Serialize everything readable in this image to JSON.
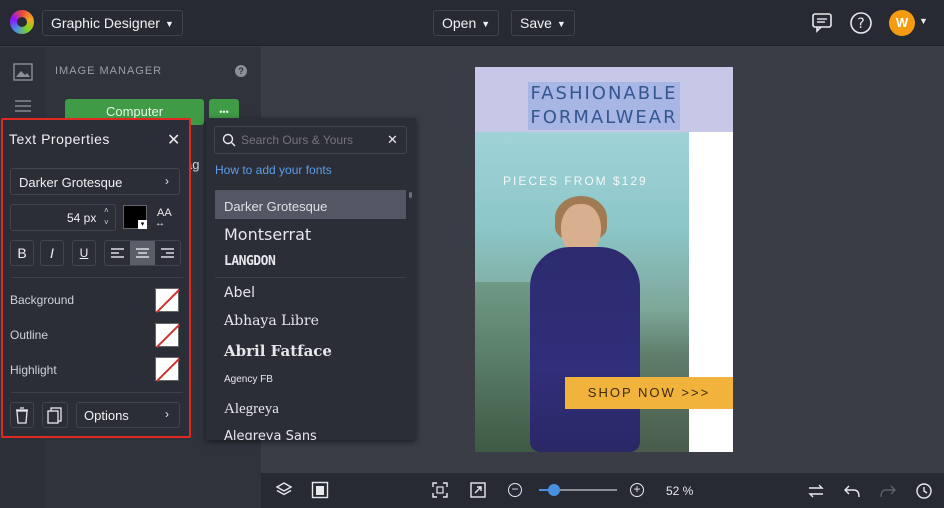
{
  "app": {
    "title_selector": "Graphic Designer"
  },
  "toolbar": {
    "open_label": "Open",
    "save_label": "Save",
    "avatar_initial": "W"
  },
  "panel": {
    "header": "IMAGE MANAGER",
    "computer_button": "Computer",
    "more_button": "•••",
    "partial_text": "ag"
  },
  "text_properties": {
    "title": "Text Properties",
    "font_name": "Darker Grotesque",
    "font_size": "54 px",
    "case_button": "AA",
    "bold": "B",
    "italic": "I",
    "underline": "U",
    "background_label": "Background",
    "outline_label": "Outline",
    "highlight_label": "Highlight",
    "options_label": "Options"
  },
  "font_dropdown": {
    "search_placeholder": "Search Ours & Yours",
    "help_link": "How to add your fonts",
    "fonts": [
      "Darker Grotesque",
      "Montserrat",
      "LANGDON",
      "Abel",
      "Abhaya Libre",
      "Abril Fatface",
      "Agency FB",
      "Alegreya",
      "Alegreya Sans"
    ],
    "selected": "Darker Grotesque"
  },
  "design": {
    "title_line1": "FASHIONABLE",
    "title_line2": "FORMALWEAR",
    "subtitle": "PIECES FROM $129",
    "cta": "SHOP NOW >>>"
  },
  "bottombar": {
    "zoom_value": 0.52,
    "zoom_label": "52 %"
  },
  "colors": {
    "accent_blue": "#4a90e2",
    "highlight_border": "#e02a1f",
    "cta": "#f2b33d",
    "avatar": "#f39c12",
    "computer_button": "#3f9b46"
  }
}
